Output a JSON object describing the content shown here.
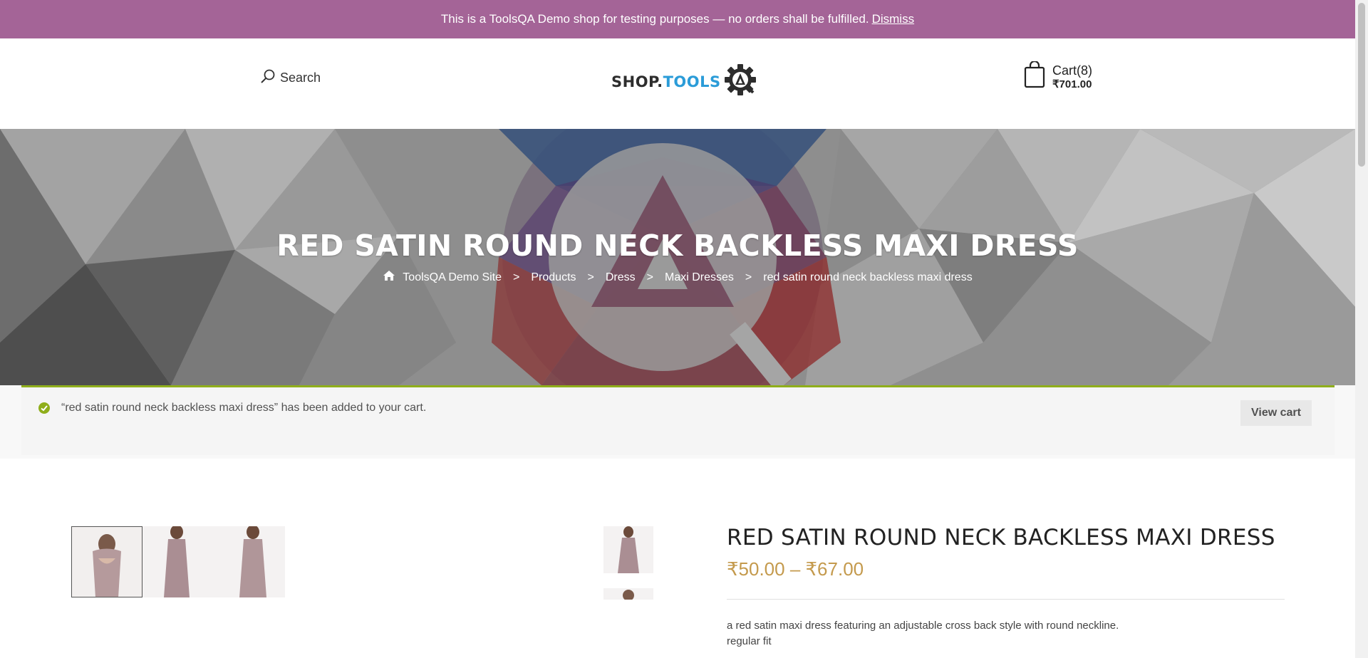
{
  "notice": {
    "text": "This is a ToolsQA Demo shop for testing purposes — no orders shall be fulfilled.",
    "dismiss": "Dismiss"
  },
  "header": {
    "search_label": "Search",
    "logo": {
      "part1": "SHOP.",
      "part2": "TOOLS",
      "emblem": "A"
    },
    "cart": {
      "label": "Cart(8)",
      "amount": "₹701.00"
    }
  },
  "hero": {
    "title": "RED SATIN ROUND NECK BACKLESS MAXI DRESS",
    "breadcrumb": [
      "ToolsQA Demo Site",
      "Products",
      "Dress",
      "Maxi Dresses",
      "red satin round neck backless maxi dress"
    ],
    "separator": ">"
  },
  "message": {
    "text": "“red satin round neck backless maxi dress” has been added to your cart.",
    "button": "View cart"
  },
  "product": {
    "title": "RED SATIN ROUND NECK BACKLESS MAXI DRESS",
    "price": "₹50.00 – ₹67.00",
    "description": [
      "a red satin maxi dress featuring an adjustable cross back style with round neckline.",
      "regular fit"
    ]
  },
  "colors": {
    "notice_bg": "#a46497",
    "success_border": "#8fae1b",
    "price": "#c49a4d",
    "logo_blue": "#2b9cd8"
  },
  "icons": [
    "search-icon",
    "gear-logo-icon",
    "shopping-bag-icon",
    "home-icon",
    "check-circle-icon"
  ]
}
